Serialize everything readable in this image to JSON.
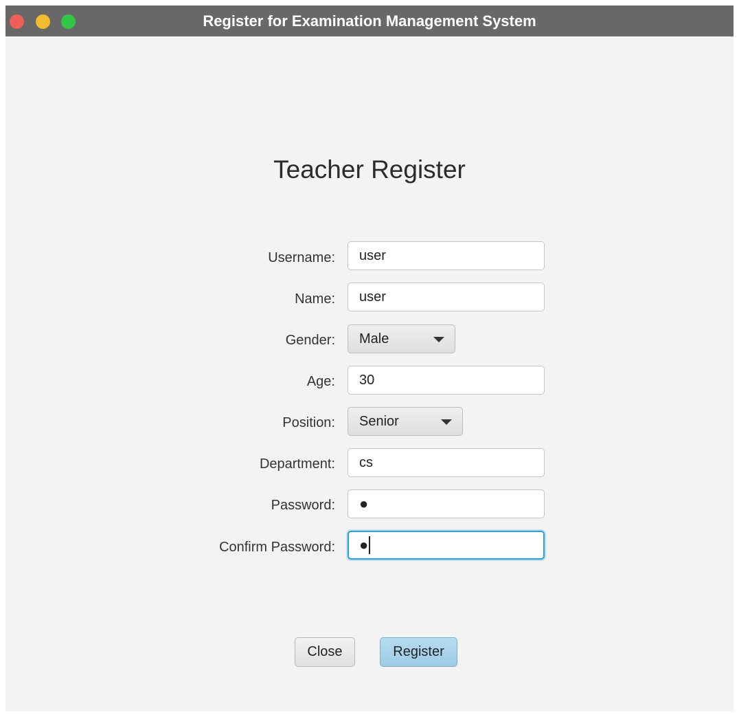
{
  "window": {
    "title": "Register for Examination Management System"
  },
  "form": {
    "title": "Teacher Register",
    "fields": {
      "username": {
        "label": "Username:",
        "value": "user"
      },
      "name": {
        "label": "Name:",
        "value": "user"
      },
      "gender": {
        "label": "Gender:",
        "selected": "Male"
      },
      "age": {
        "label": "Age:",
        "value": "30"
      },
      "position": {
        "label": "Position:",
        "selected": "Senior"
      },
      "department": {
        "label": "Department:",
        "value": "cs"
      },
      "password": {
        "label": "Password:",
        "masked_value": "●"
      },
      "confirm_password": {
        "label": "Confirm Password:",
        "masked_value": "●"
      }
    }
  },
  "buttons": {
    "close": "Close",
    "register": "Register"
  },
  "colors": {
    "titlebar": "#686868",
    "background": "#f3f3f3",
    "focus_ring": "#2aa0d8",
    "register_button": "#9ccbe5"
  },
  "icons": {
    "traffic_close": "close-window-icon",
    "traffic_minimize": "minimize-window-icon",
    "traffic_zoom": "zoom-window-icon",
    "dropdown": "chevron-down-icon"
  }
}
